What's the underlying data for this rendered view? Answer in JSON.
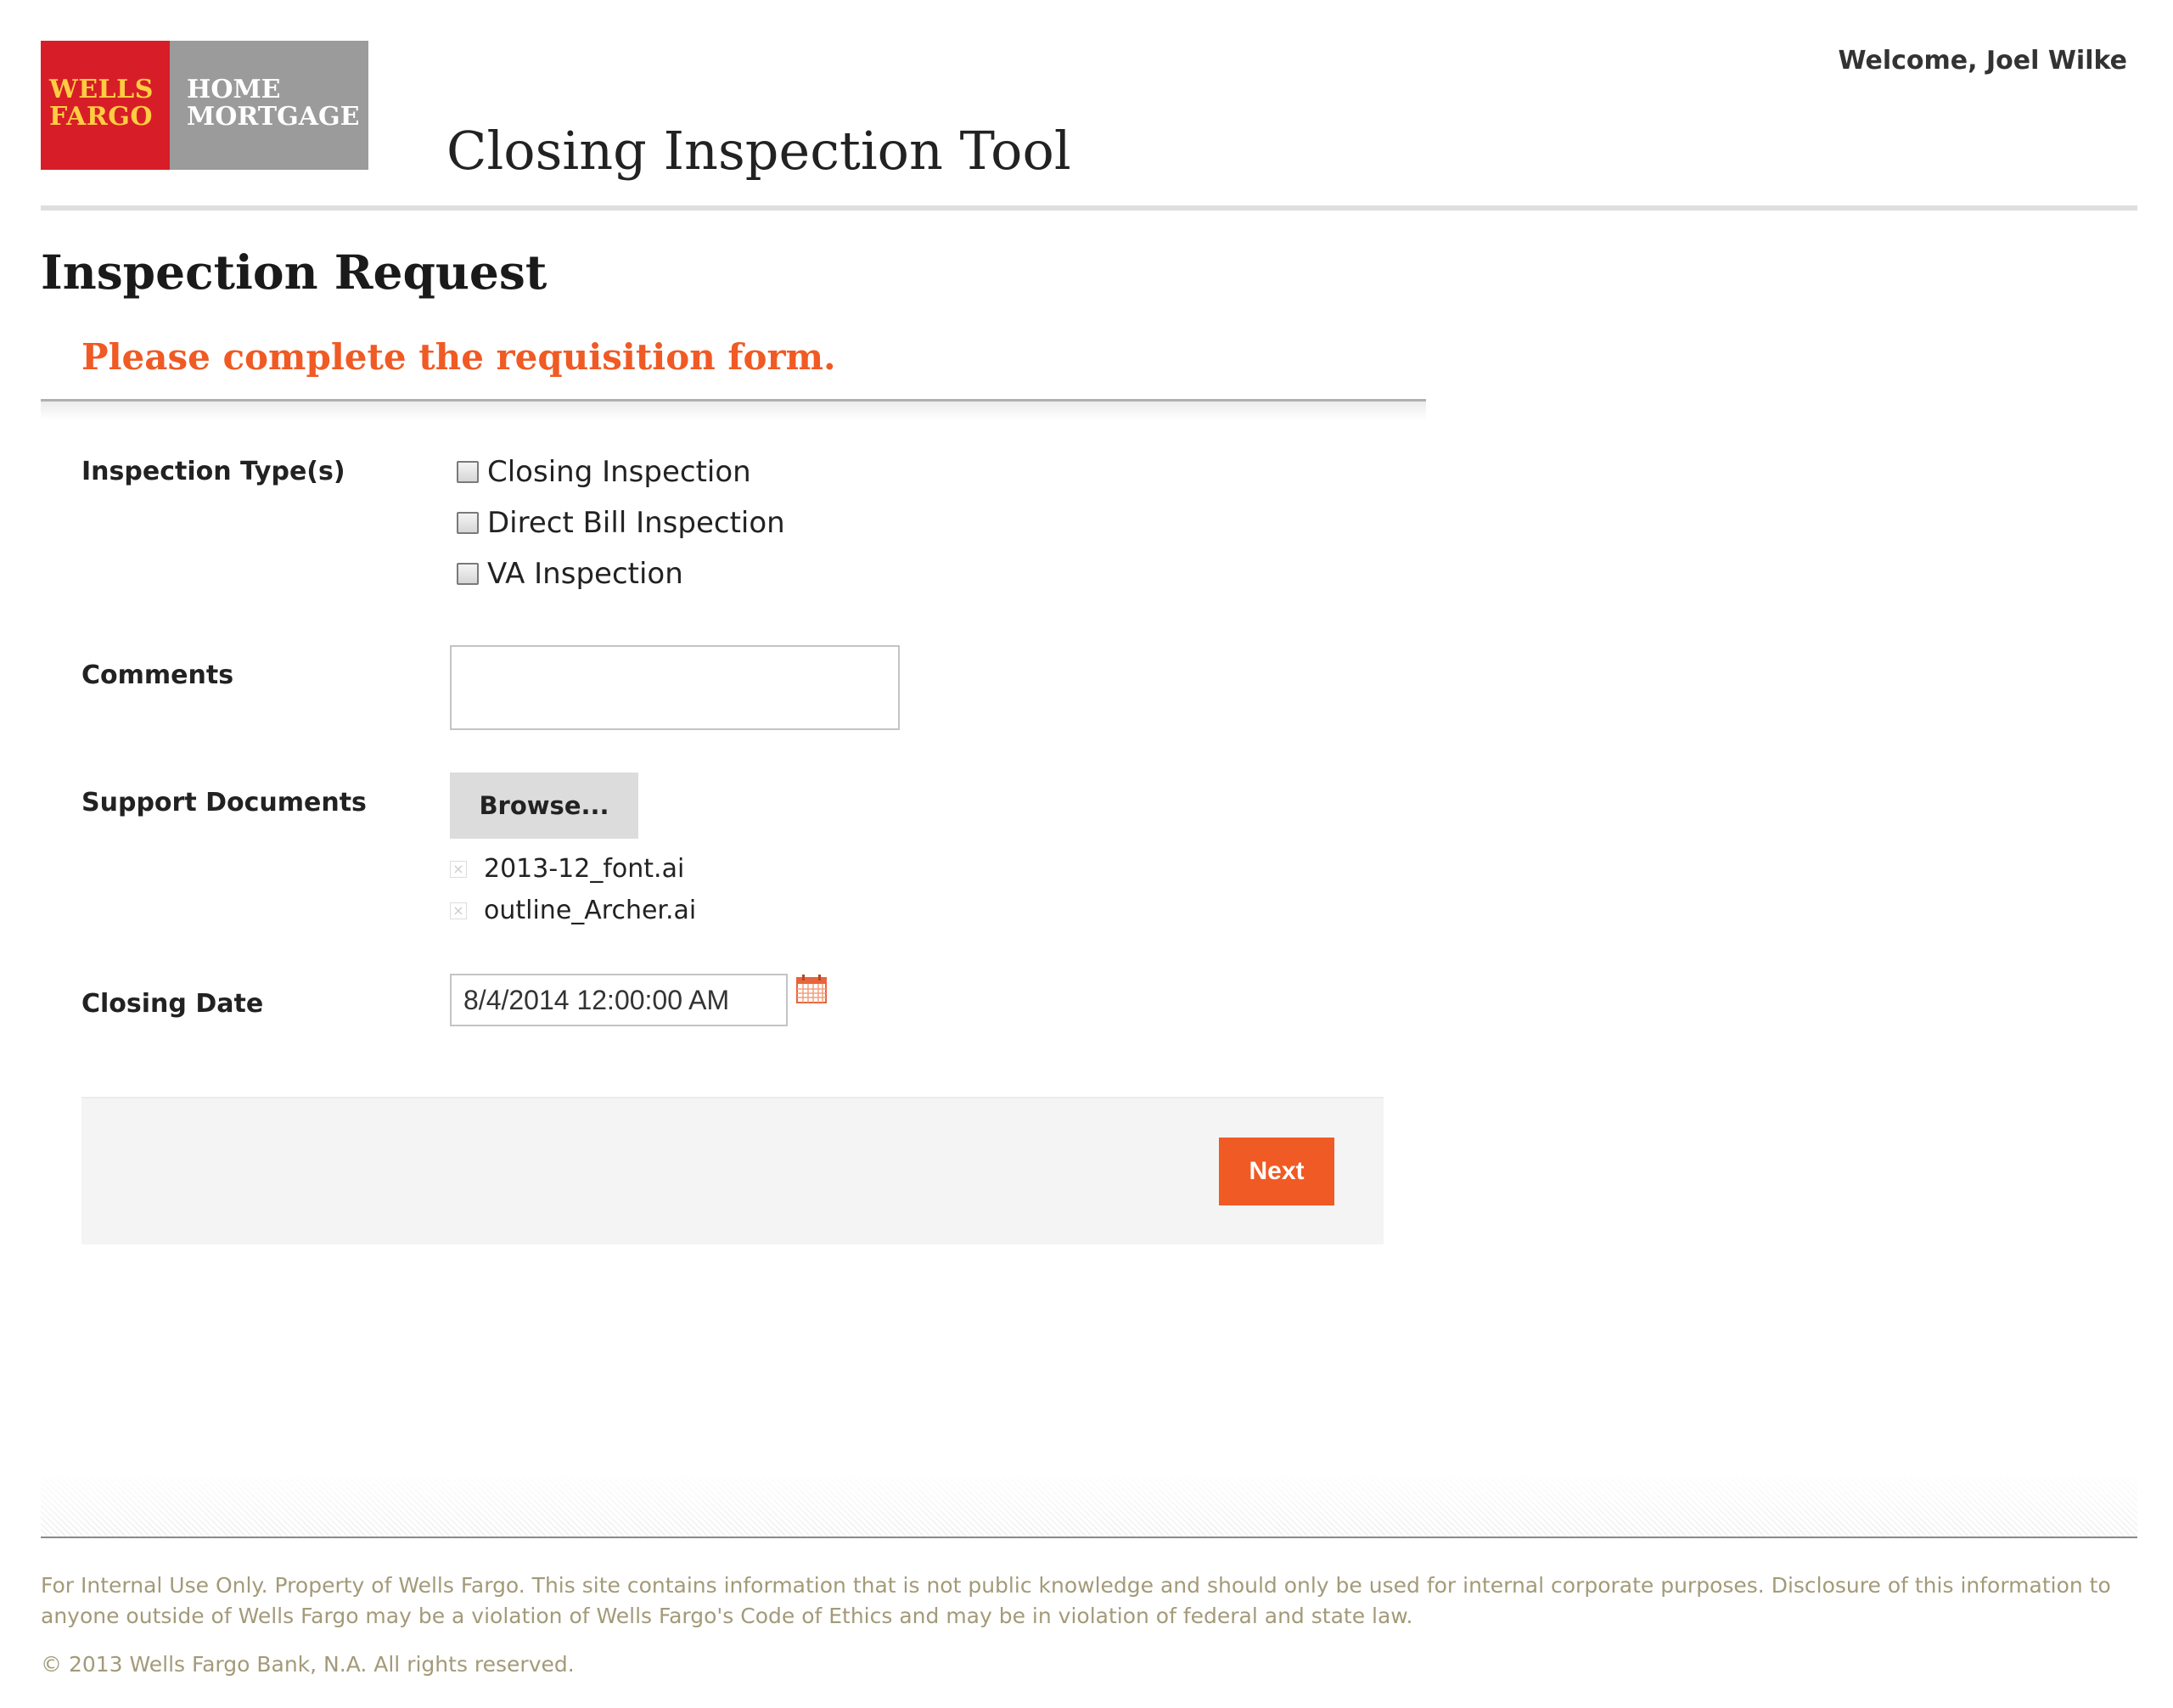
{
  "header": {
    "logo": {
      "bank_line1": "WELLS",
      "bank_line2": "FARGO",
      "unit_line1": "HOME",
      "unit_line2": "MORTGAGE"
    },
    "app_title": "Closing Inspection Tool",
    "welcome": "Welcome, Joel Wilke"
  },
  "page": {
    "title": "Inspection Request",
    "subtitle": "Please complete the requisition form."
  },
  "form": {
    "inspection_types_label": "Inspection Type(s)",
    "inspection_types": [
      {
        "label": "Closing Inspection",
        "checked": false
      },
      {
        "label": "Direct Bill Inspection",
        "checked": false
      },
      {
        "label": "VA Inspection",
        "checked": false
      }
    ],
    "comments_label": "Comments",
    "comments_value": "",
    "support_documents_label": "Support Documents",
    "browse_label": "Browse...",
    "documents": [
      "2013-12_font.ai",
      "outline_Archer.ai"
    ],
    "closing_date_label": "Closing Date",
    "closing_date_value": "8/4/2014 12:00:00 AM",
    "next_label": "Next"
  },
  "footer": {
    "disclaimer": "For Internal Use Only. Property of Wells Fargo. This site contains information that is not public knowledge and should only be used for internal corporate purposes. Disclosure of this information to anyone outside of Wells Fargo may be a violation of Wells Fargo's Code of Ethics and may be in violation of federal and state law.",
    "copyright": "© 2013 Wells Fargo Bank, N.A. All rights reserved."
  },
  "colors": {
    "brand_red": "#d71e28",
    "brand_gold": "#ffcd41",
    "accent_orange": "#f05a24",
    "footer_text": "#a39a78"
  },
  "icons": {
    "calendar": "calendar-icon",
    "remove_file": "remove-file-icon"
  }
}
